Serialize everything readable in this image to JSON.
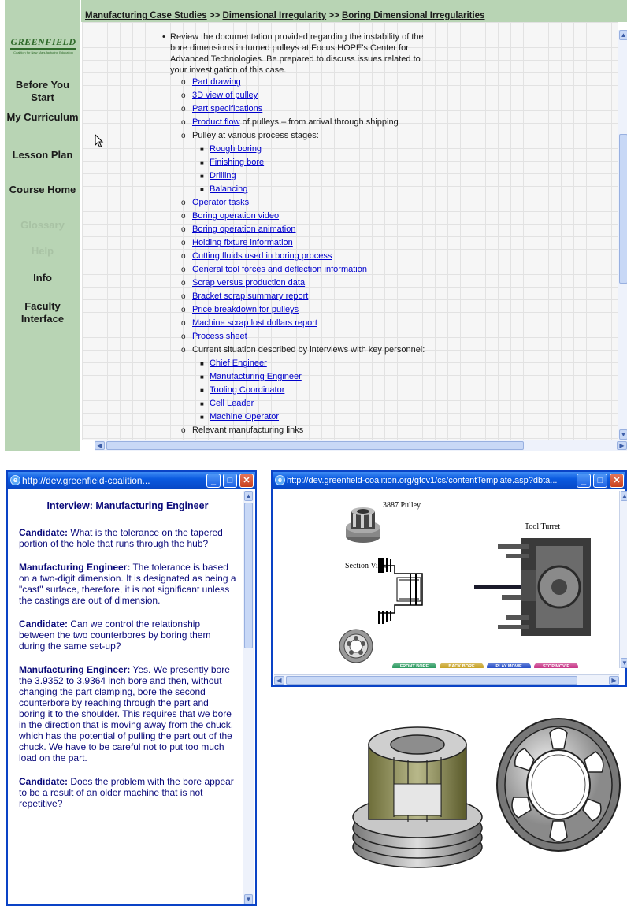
{
  "top_window": {
    "breadcrumb": [
      "Manufacturing Case Studies",
      "Dimensional Irregularity",
      "Boring Dimensional Irregularities"
    ],
    "breadcrumb_sep": ">>",
    "logo": {
      "text": "GREENFIELD",
      "tagline": "Coalition for New Manufacturing Education"
    },
    "nav": [
      {
        "label": "Before You Start",
        "enabled": true
      },
      {
        "label": "My Curriculum",
        "enabled": true
      },
      {
        "label": "Lesson Plan",
        "enabled": true
      },
      {
        "label": "Course Home",
        "enabled": true
      },
      {
        "label": "Glossary",
        "enabled": false
      },
      {
        "label": "Help",
        "enabled": false
      },
      {
        "label": "Info",
        "enabled": true
      },
      {
        "label": "Faculty Interface",
        "enabled": true
      }
    ],
    "intro": "Review the documentation provided regarding the instability of the bore dimensions in turned pulleys at Focus:HOPE's Center for Advanced Technologies. Be prepared to discuss issues related to your investigation of this case.",
    "items": [
      {
        "link": "Part drawing"
      },
      {
        "link": "3D view of pulley"
      },
      {
        "link": "Part specifications"
      },
      {
        "link": "Product flow",
        "suffix": " of pulleys – from arrival through shipping"
      },
      {
        "text": "Pulley at various process stages:",
        "sub": [
          "Rough boring",
          "Finishing bore",
          "Drilling",
          "Balancing"
        ]
      },
      {
        "link": "Operator tasks"
      },
      {
        "link": "Boring operation video"
      },
      {
        "link": "Boring operation animation"
      },
      {
        "link": "Holding fixture information"
      },
      {
        "link": "Cutting fluids used in boring process"
      },
      {
        "link": "General tool forces and deflection information"
      },
      {
        "link": "Scrap versus production data"
      },
      {
        "link": "Bracket scrap summary report"
      },
      {
        "link": "Price breakdown for pulleys"
      },
      {
        "link": "Machine scrap lost dollars report"
      },
      {
        "link": "Process sheet"
      },
      {
        "text": "Current situation described by interviews with key personnel:",
        "sub": [
          "Chief Engineer",
          "Manufacturing Engineer",
          "Tooling Coordinator",
          "Cell Leader",
          "Machine Operator"
        ]
      },
      {
        "text": "Relevant manufacturing links"
      }
    ]
  },
  "interview_window": {
    "title": "http://dev.greenfield-coalition...",
    "heading": "Interview: Manufacturing Engineer",
    "paragraphs": [
      {
        "speaker": "Candidate:",
        "text": " What is the tolerance on the tapered portion of the hole that runs through the hub?"
      },
      {
        "speaker": "Manufacturing Engineer:",
        "text": " The tolerance is based on a two-digit dimension. It is designated as being a \"cast\" surface, therefore, it is not significant unless the castings are out of dimension."
      },
      {
        "speaker": "Candidate:",
        "text": " Can we control the relationship between the two counterbores by boring them during the same set-up?"
      },
      {
        "speaker": "Manufacturing Engineer:",
        "text": " Yes. We presently bore the 3.9352 to 3.9364 inch bore and then, without changing the part clamping, bore the second counterbore by reaching through the part and boring it to the shoulder. This requires that we bore in the direction that is moving away from the chuck, which has the potential of pulling the part out of the chuck. We have to be careful not to put too much load on the part."
      },
      {
        "speaker": "Candidate:",
        "text": " Does the problem with the bore appear to be a result of an older machine that is not repetitive?"
      }
    ]
  },
  "animation_window": {
    "title": "http://dev.greenfield-coalition.org/gfcv1/cs/contentTemplate.asp?dbta...",
    "labels": {
      "pulley": "3887 Pulley",
      "turret": "Tool Turret",
      "section": "Section View"
    },
    "buttons": [
      {
        "label": "FRONT BORE",
        "color": "#2f9d63"
      },
      {
        "label": "BACK BORE",
        "color": "#c9a52b"
      },
      {
        "label": "PLAY MOVIE",
        "color": "#2d54c9"
      },
      {
        "label": "STOP MOVIE",
        "color": "#c93a8a"
      }
    ]
  },
  "colors": {
    "sidebar": "#b8d4b4",
    "link": "#0000cc",
    "interview_text": "#0a0a7a",
    "titlebar": "#0a5ae0"
  }
}
